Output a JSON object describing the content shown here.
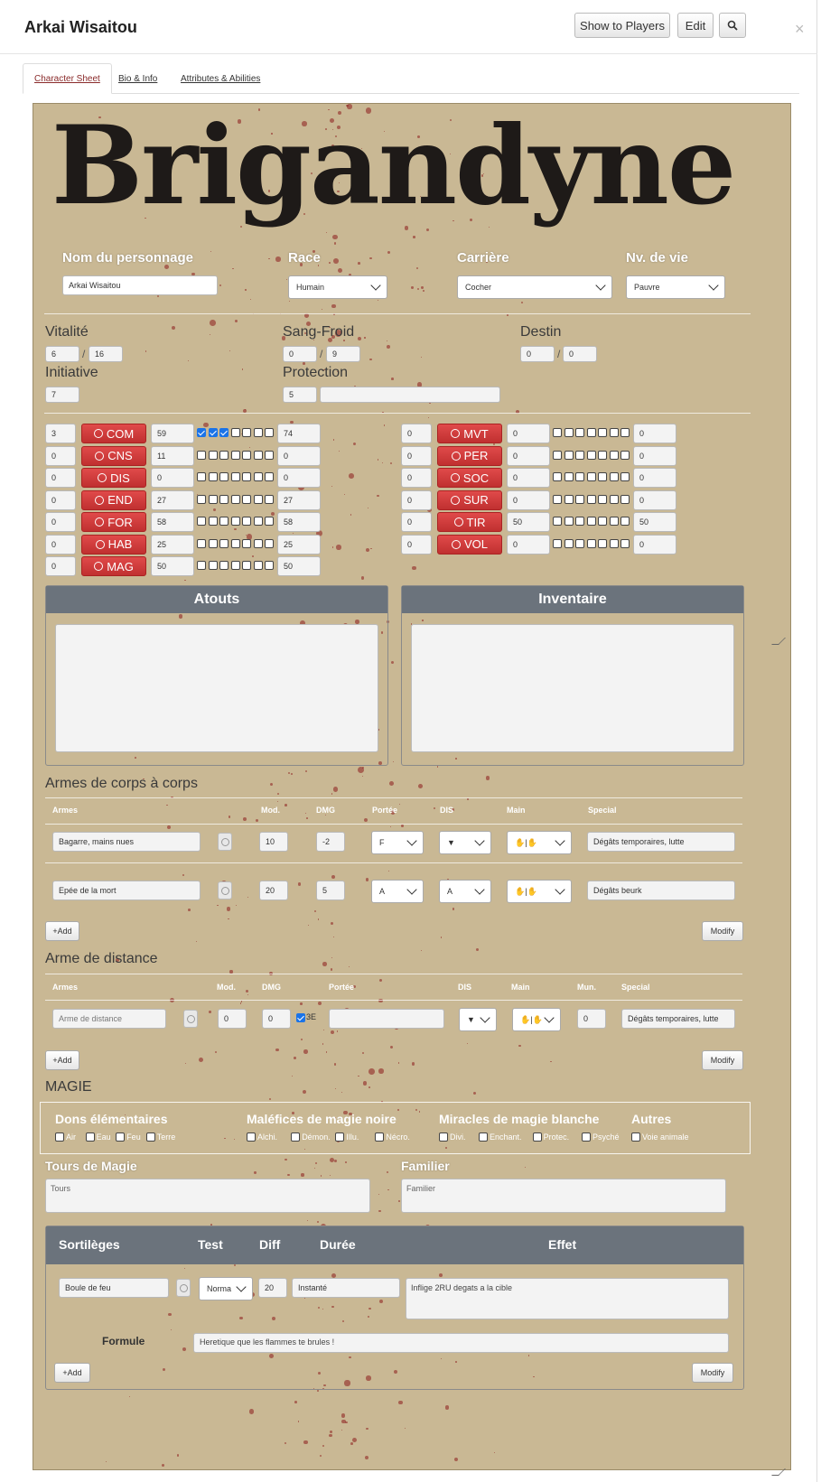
{
  "header": {
    "title": "Arkai Wisaitou",
    "show_players_label": "Show to Players",
    "edit_label": "Edit",
    "close_glyph": "×"
  },
  "tabs": [
    "Character Sheet",
    "Bio & Info",
    "Attributes & Abilities"
  ],
  "logo_text": "Brigandyne",
  "identity": {
    "name_label": "Nom du personnage",
    "name_value": "Arkai Wisaitou",
    "race_label": "Race",
    "race_value": "Humain",
    "career_label": "Carrière",
    "career_value": "Cocher",
    "life_label": "Nv. de vie",
    "life_value": "Pauvre"
  },
  "vitals": {
    "vitalite_label": "Vitalité",
    "vitalite_cur": "6",
    "vitalite_max": "16",
    "sang_froid_label": "Sang-Froid",
    "sang_froid_cur": "0",
    "sang_froid_max": "9",
    "destin_label": "Destin",
    "destin_cur": "0",
    "destin_max": "0",
    "initiative_label": "Initiative",
    "initiative_value": "7",
    "protection_label": "Protection",
    "protection_value": "5",
    "protection_text": ""
  },
  "stats_left": [
    {
      "mod": "3",
      "name": "COM",
      "base": "59",
      "checks": 3,
      "total": "74"
    },
    {
      "mod": "0",
      "name": "CNS",
      "base": "11",
      "checks": 0,
      "total": "0"
    },
    {
      "mod": "0",
      "name": "DIS",
      "base": "0",
      "checks": 0,
      "total": "0"
    },
    {
      "mod": "0",
      "name": "END",
      "base": "27",
      "checks": 0,
      "total": "27"
    },
    {
      "mod": "0",
      "name": "FOR",
      "base": "58",
      "checks": 0,
      "total": "58"
    },
    {
      "mod": "0",
      "name": "HAB",
      "base": "25",
      "checks": 0,
      "total": "25"
    },
    {
      "mod": "0",
      "name": "MAG",
      "base": "50",
      "checks": 0,
      "total": "50"
    }
  ],
  "stats_right": [
    {
      "mod": "0",
      "name": "MVT",
      "base": "0",
      "checks": 0,
      "total": "0"
    },
    {
      "mod": "0",
      "name": "PER",
      "base": "0",
      "checks": 0,
      "total": "0"
    },
    {
      "mod": "0",
      "name": "SOC",
      "base": "0",
      "checks": 0,
      "total": "0"
    },
    {
      "mod": "0",
      "name": "SUR",
      "base": "0",
      "checks": 0,
      "total": "0"
    },
    {
      "mod": "0",
      "name": "TIR",
      "base": "50",
      "checks": 0,
      "total": "50"
    },
    {
      "mod": "0",
      "name": "VOL",
      "base": "0",
      "checks": 0,
      "total": "0"
    }
  ],
  "panels": {
    "atouts": "Atouts",
    "inventaire": "Inventaire"
  },
  "melee": {
    "title": "Armes de corps à corps",
    "headers": [
      "Armes",
      "Mod.",
      "DMG",
      "Portée",
      "DIS",
      "Main",
      "Special"
    ],
    "rows": [
      {
        "name": "Bagarre, mains nues",
        "mod": "10",
        "dmg": "-2",
        "portee": "F",
        "dis": "▼",
        "main": "✋|✋",
        "special": "Dégâts temporaires, lutte"
      },
      {
        "name": "Epée de la mort",
        "mod": "20",
        "dmg": "5",
        "portee": "A",
        "dis": "A",
        "main": "✋|✋",
        "special": "Dégâts beurk"
      }
    ],
    "add_label": "+Add",
    "modify_label": "Modify"
  },
  "ranged": {
    "title": "Arme de distance",
    "headers": [
      "Armes",
      "Mod.",
      "DMG",
      "Portée",
      "DIS",
      "Main",
      "Mun.",
      "Special"
    ],
    "row": {
      "name_placeholder": "Arme de distance",
      "mod": "0",
      "dmg": "0",
      "check_text": "3E",
      "portee": "",
      "dis": "▼",
      "main": "✋|✋",
      "mun": "0",
      "special": "Dégâts temporaires, lutte"
    },
    "add_label": "+Add",
    "modify_label": "Modify"
  },
  "magie": {
    "title": "MAGIE",
    "groups": [
      {
        "title": "Dons élémentaires",
        "options": [
          "Air",
          "Eau",
          "Feu",
          "Terre"
        ]
      },
      {
        "title": "Maléfices de magie noire",
        "options": [
          "Alchi.",
          "Démon.",
          "Illu.",
          "Nécro."
        ]
      },
      {
        "title": "Miracles de magie blanche",
        "options": [
          "Divi.",
          "Enchant.",
          "Protec.",
          "Psyché"
        ]
      },
      {
        "title": "Autres",
        "options": [
          "Voie animale"
        ]
      }
    ],
    "tours_label": "Tours de Magie",
    "tours_placeholder": "Tours",
    "familier_label": "Familier",
    "familier_placeholder": "Familier"
  },
  "spells": {
    "headers": [
      "Sortilèges",
      "Test",
      "Diff",
      "Durée",
      "Effet"
    ],
    "row": {
      "name": "Boule de feu",
      "test": "Norma",
      "diff": "20",
      "duree": "Instanté",
      "effet": "Inflige 2RU degats a la cible"
    },
    "formule_label": "Formule",
    "formule_value": "Heretique que les flammes te brules !",
    "add_label": "+Add",
    "modify_label": "Modify"
  },
  "colors": {
    "accent_red": "#c83a3a",
    "panel_head": "#6b737c",
    "parchment": "#c9b894",
    "blood": "#8b1a1a"
  }
}
